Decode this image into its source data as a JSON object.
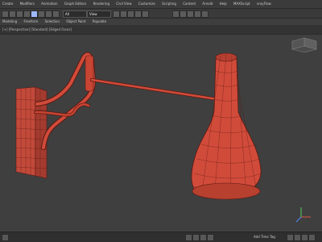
{
  "menu": {
    "items": [
      "Create",
      "Modifiers",
      "Animation",
      "Graph Editors",
      "Rendering",
      "Civil View",
      "Customize",
      "Scripting",
      "Content",
      "Arnold",
      "Help",
      "MAXScript",
      "vrayFlow"
    ]
  },
  "toolbar": {
    "selection_filter": "All",
    "view_dropdown": "View",
    "active_tool": "select"
  },
  "ribbon": {
    "tabs": [
      "Modeling",
      "Freeform",
      "Selection",
      "Object Paint",
      "Populate"
    ]
  },
  "viewport": {
    "label": "[+] [Perspective] [Standard] [Edged Faces]",
    "mesh_color": "#d14b3a",
    "wire_color": "#5a1a13",
    "background": "#3f3f3f"
  },
  "statusbar": {
    "text": "Add Time Tag"
  }
}
